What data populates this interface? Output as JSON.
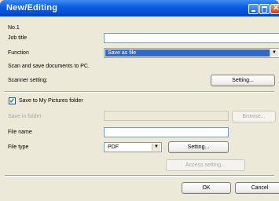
{
  "window": {
    "title": "New/Editing"
  },
  "form": {
    "number_label": "No.1",
    "job_title_label": "Job title",
    "job_title_value": "",
    "function_label": "Function",
    "function_value": "Save as file",
    "description": "Scan and save documents to PC.",
    "scanner_setting_label": "Scanner setting:",
    "scanner_setting_button": "Setting...",
    "save_to_pictures_label": "Save to My Pictures folder",
    "save_to_pictures_checked": true,
    "save_in_folder_label": "Save in folder",
    "browse_button": "Browse...",
    "file_name_label": "File name",
    "file_name_value": "",
    "file_type_label": "File type",
    "file_type_value": "PDF",
    "file_type_setting_button": "Setting...",
    "access_setting_button": "Access setting..."
  },
  "footer": {
    "ok_button": "OK",
    "cancel_button": "Cancel"
  },
  "icons": {
    "check": "✔",
    "dropdown": "▼"
  }
}
